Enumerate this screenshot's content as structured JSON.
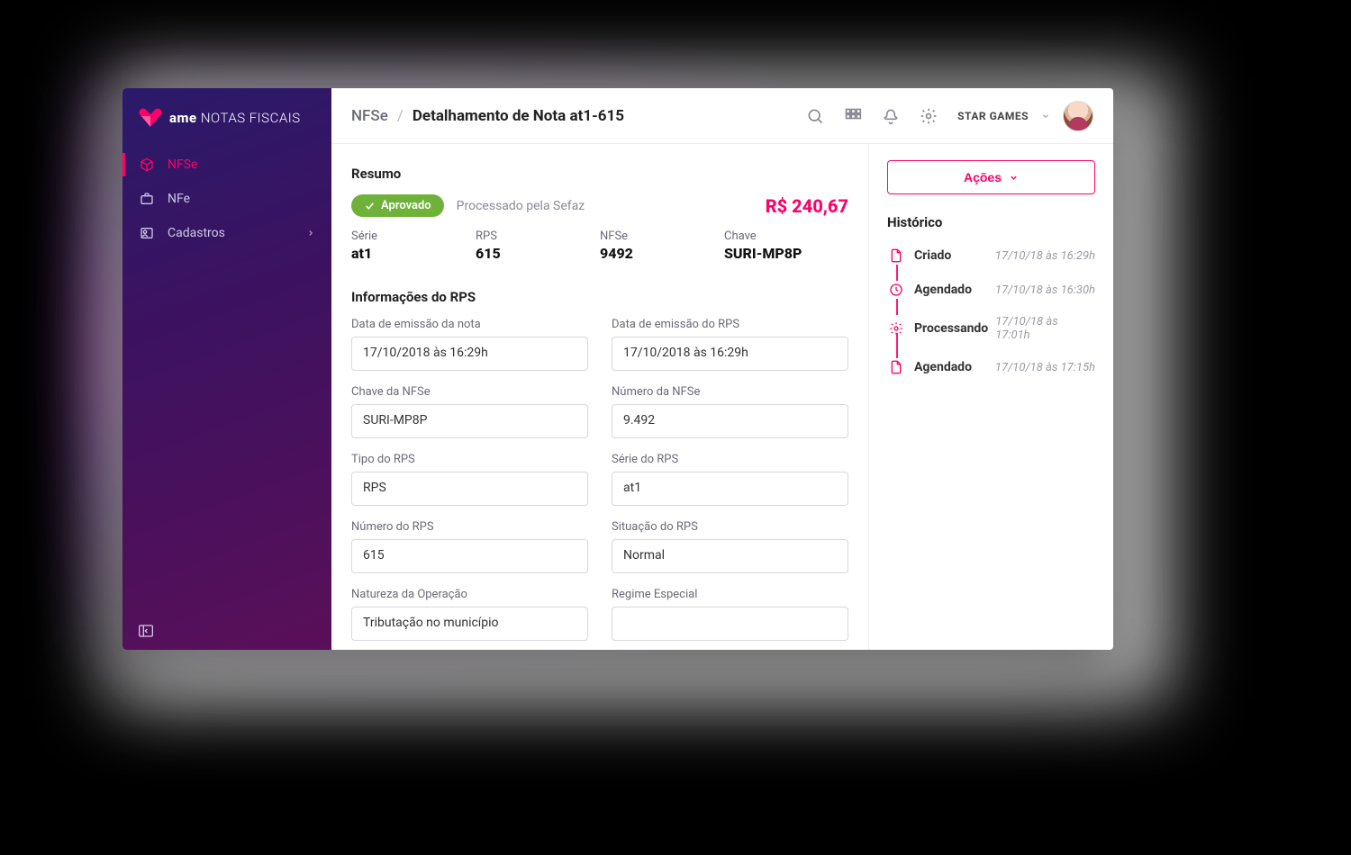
{
  "brand": {
    "name_bold": "ame",
    "name_rest": "NOTAS FISCAIS"
  },
  "sidebar": {
    "items": [
      {
        "label": "NFSe",
        "active": true
      },
      {
        "label": "NFe"
      },
      {
        "label": "Cadastros",
        "has_children": true
      }
    ]
  },
  "breadcrumb": {
    "root": "NFSe",
    "current": "Detalhamento de Nota at1-615"
  },
  "account": {
    "name": "STAR GAMES"
  },
  "summary": {
    "title": "Resumo",
    "badge": "Aprovado",
    "status_note": "Processado pela Sefaz",
    "amount": "R$ 240,67",
    "serie_label": "Série",
    "serie": "at1",
    "rps_label": "RPS",
    "rps": "615",
    "nfse_label": "NFSe",
    "nfse": "9492",
    "chave_label": "Chave",
    "chave": "SURI-MP8P"
  },
  "rps_info": {
    "title": "Informações do RPS",
    "fields": {
      "data_emissao_nota": {
        "label": "Data de emissão da nota",
        "value": "17/10/2018 às 16:29h"
      },
      "data_emissao_rps": {
        "label": "Data de emissão do RPS",
        "value": "17/10/2018 às 16:29h"
      },
      "chave_nfse": {
        "label": "Chave da NFSe",
        "value": "SURI-MP8P"
      },
      "numero_nfse": {
        "label": "Número da NFSe",
        "value": "9.492"
      },
      "tipo_rps": {
        "label": "Tipo do RPS",
        "value": "RPS"
      },
      "serie_rps": {
        "label": "Série do RPS",
        "value": "at1"
      },
      "numero_rps": {
        "label": "Número do RPS",
        "value": "615"
      },
      "situacao_rps": {
        "label": "Situação do RPS",
        "value": "Normal"
      },
      "natureza": {
        "label": "Natureza da Operação",
        "value": "Tributação no município"
      },
      "regime_especial": {
        "label": "Regime Especial",
        "value": ""
      }
    }
  },
  "right": {
    "actions_label": "Ações",
    "history_title": "Histórico",
    "history": [
      {
        "label": "Criado",
        "ts": "17/10/18 às 16:29h",
        "icon": "file"
      },
      {
        "label": "Agendado",
        "ts": "17/10/18 às 16:30h",
        "icon": "clock"
      },
      {
        "label": "Processando",
        "ts": "17/10/18 às 17:01h",
        "icon": "gear"
      },
      {
        "label": "Agendado",
        "ts": "17/10/18 às 17:15h",
        "icon": "file"
      }
    ]
  }
}
